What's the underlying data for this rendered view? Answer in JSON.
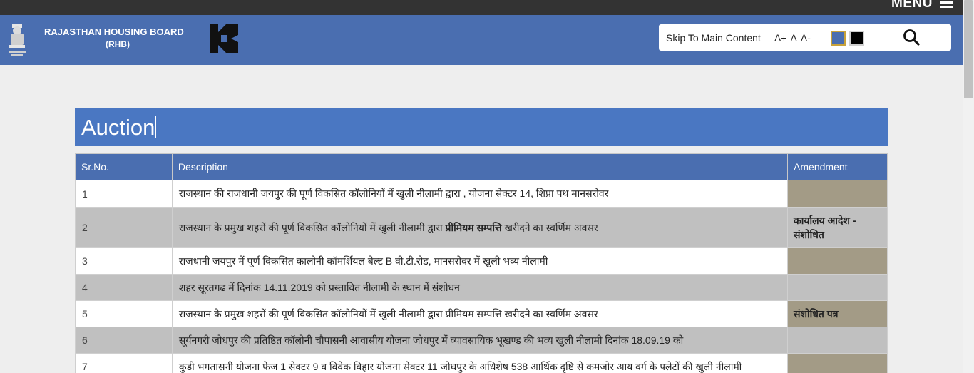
{
  "topbar": {
    "menu_label": "MENU"
  },
  "header": {
    "org_name": "RAJASTHAN HOUSING BOARD",
    "org_abbr": "(RHB)"
  },
  "toolbox": {
    "skip_label": "Skip To Main Content",
    "font_increase": "A+",
    "font_normal": "A",
    "font_decrease": "A-",
    "theme_blue": "#4a6eb0",
    "theme_black": "#000000"
  },
  "page": {
    "title": "Auction"
  },
  "table": {
    "headers": {
      "sr": "Sr.No.",
      "desc": "Description",
      "amend": "Amendment"
    },
    "rows": [
      {
        "sr": "1",
        "desc": "राजस्थान की राजधानी जयपुर की  पूर्ण विकसित कॉलोनियों में खुली नीलामी द्वारा , योजना सेक्टर 14, शिप्रा पथ  मानसरोवर",
        "amend": ""
      },
      {
        "sr": "2",
        "desc_pre": "राजस्थान के प्रमुख शहरों की पूर्ण विकसित कॉलोनियों में खुली नीलामी द्वारा ",
        "desc_bold": "प्रीमियम सम्पत्ति",
        "desc_post": " खरीदने का स्वर्णिम अवसर",
        "amend": "कार्यालय आदेश - संशोधित"
      },
      {
        "sr": "3",
        "desc": "राजधानी जयपुर में पूर्ण विकसित कालोनी कॉमर्शियल बेल्ट B वी.टी.रोड, मानसरोवर में खुली भव्य नीलामी",
        "amend": ""
      },
      {
        "sr": "4",
        "desc": "शहर सूरतगढ में दिनांक 14.11.2019 को प्रस्तावित नीलामी के स्थान में संशोधन",
        "amend": ""
      },
      {
        "sr": "5",
        "desc": "राजस्थान के प्रमुख शहरों की पूर्ण विकसित कॉलोनियों में खुली नीलामी द्वारा प्रीमियम सम्पत्ति खरीदने का स्वर्णिम अवसर",
        "amend": "संशोधित पत्र"
      },
      {
        "sr": "6",
        "desc": "सूर्यनगरी जोधपुर की प्रतिष्ठित कॉलोनी चौपासनी आवासीय योजना जोधपुर में व्यावसायिक भूखण्ड की भव्य खुली नीलामी दिनांक 18.09.19 को",
        "amend": ""
      },
      {
        "sr": "7",
        "desc": "कुडी भगतासनी योजना फेज 1 सेक्टर 9 व विवेक विहार योजना सेक्टर 11 जोधपुर के अधिशेष 538 आर्थिक दृष्टि से कमजोर आय वर्ग के फ्लेटों की खुली नीलामी",
        "amend": ""
      }
    ]
  }
}
